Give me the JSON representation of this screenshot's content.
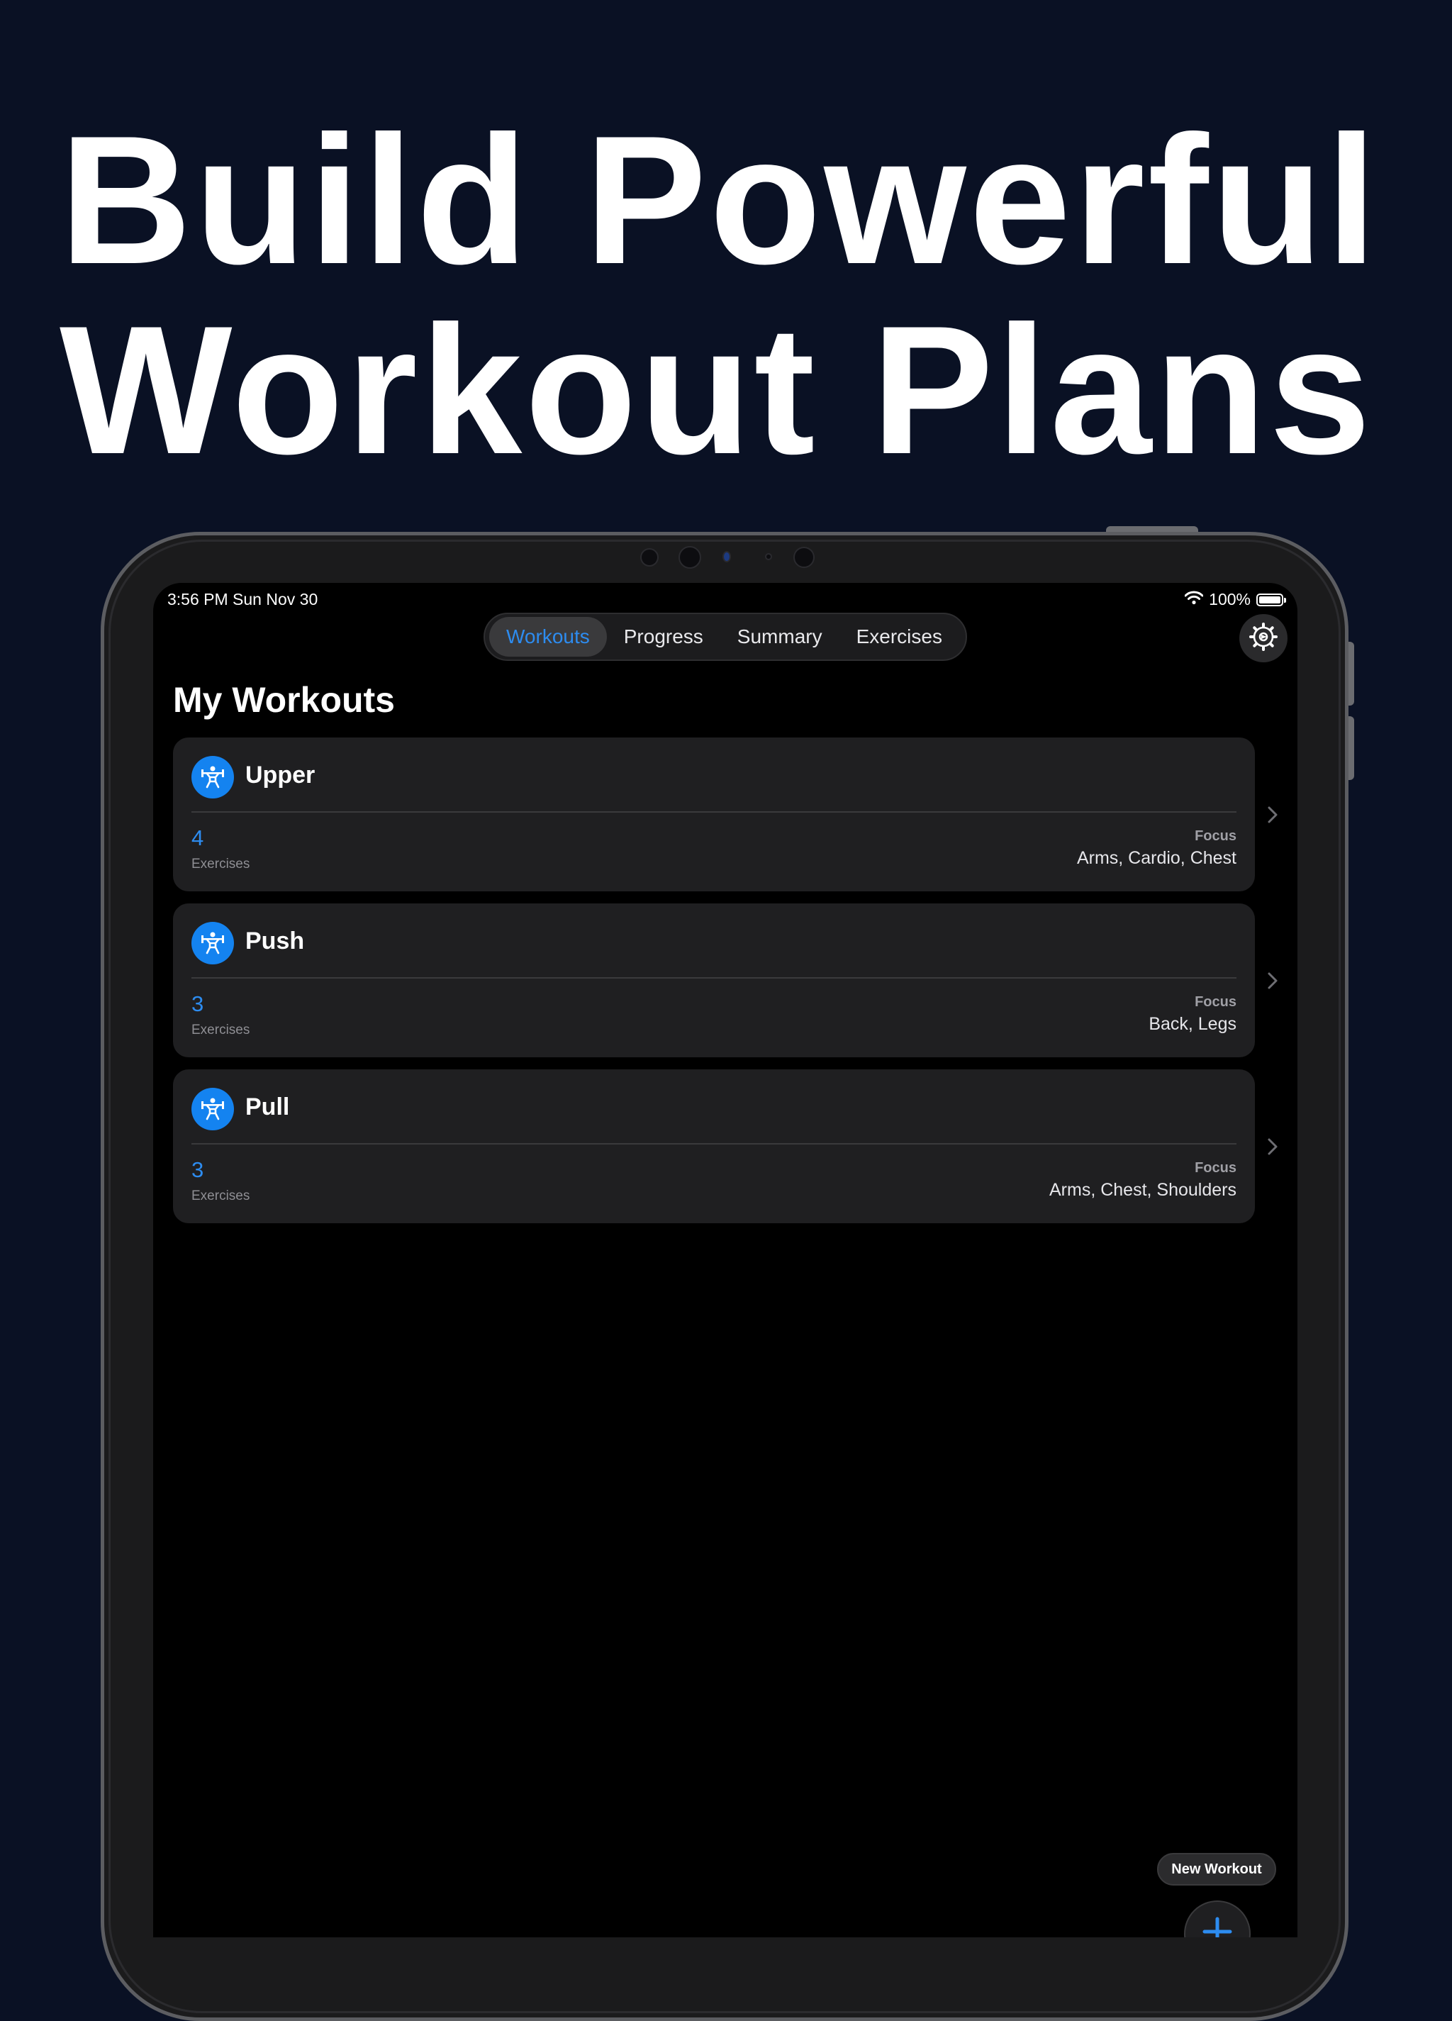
{
  "headline": {
    "line1": "Build Powerful",
    "line2": "Workout Plans"
  },
  "status_bar": {
    "time_date": "3:56 PM  Sun Nov 30",
    "battery": "100%",
    "battery_level": 1.0
  },
  "tabs": [
    {
      "label": "Workouts",
      "active": true
    },
    {
      "label": "Progress",
      "active": false
    },
    {
      "label": "Summary",
      "active": false
    },
    {
      "label": "Exercises",
      "active": false
    }
  ],
  "page_title": "My Workouts",
  "workouts": [
    {
      "name": "Upper",
      "count": "4",
      "count_label": "Exercises",
      "focus_label": "Focus",
      "focus": "Arms, Cardio, Chest"
    },
    {
      "name": "Push",
      "count": "3",
      "count_label": "Exercises",
      "focus_label": "Focus",
      "focus": "Back, Legs"
    },
    {
      "name": "Pull",
      "count": "3",
      "count_label": "Exercises",
      "focus_label": "Focus",
      "focus": "Arms, Chest, Shoulders"
    }
  ],
  "new_workout_label": "New Workout",
  "icons": {
    "settings": "gear-icon",
    "workout": "weightlifter-icon",
    "chevron": "chevron-right-icon",
    "add": "plus-icon",
    "wifi": "wifi-icon",
    "battery": "battery-icon"
  },
  "colors": {
    "background": "#0a1124",
    "accent": "#2d8cf0",
    "badge": "#1483f0",
    "card": "#1f1f21"
  }
}
